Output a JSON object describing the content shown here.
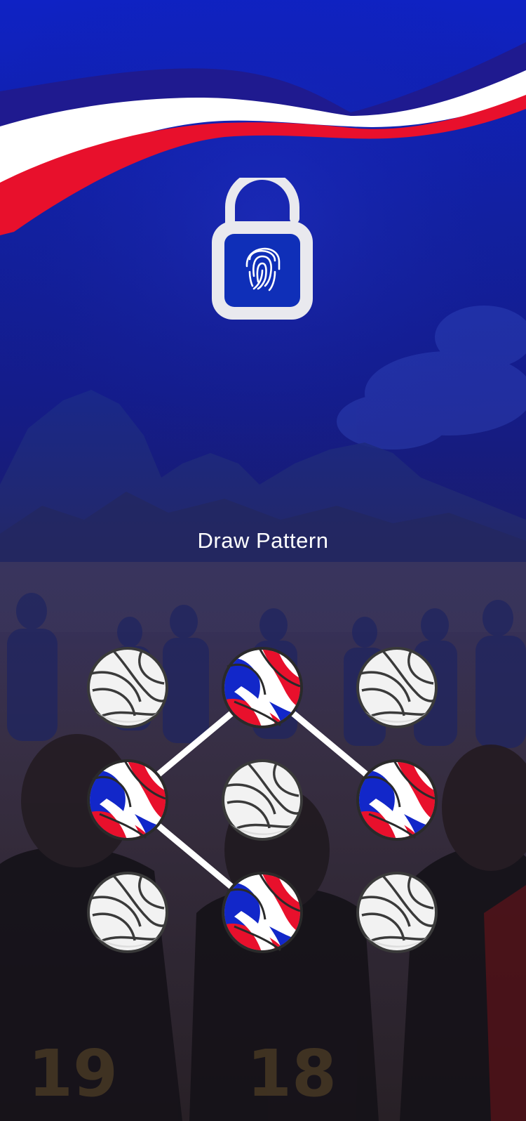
{
  "screen": {
    "title": "Draw Pattern"
  },
  "lock": {
    "icon": "fingerprint-padlock-icon"
  },
  "theme": {
    "primary_blue": "#1227c9",
    "flag_red": "#e8102c",
    "flag_white": "#ffffff",
    "flag_navy": "#1f1a8f",
    "ball_white": "#f1f1f1",
    "pattern_line": "#ffffff"
  },
  "pattern": {
    "nodes": [
      {
        "id": 1,
        "selected": false
      },
      {
        "id": 2,
        "selected": true
      },
      {
        "id": 3,
        "selected": false
      },
      {
        "id": 4,
        "selected": true
      },
      {
        "id": 5,
        "selected": false
      },
      {
        "id": 6,
        "selected": true
      },
      {
        "id": 7,
        "selected": false
      },
      {
        "id": 8,
        "selected": true
      },
      {
        "id": 9,
        "selected": false
      }
    ],
    "path": [
      6,
      2,
      4,
      8
    ]
  }
}
